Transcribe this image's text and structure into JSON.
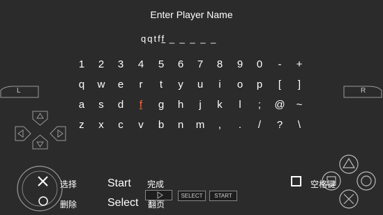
{
  "title": "Enter Player Name",
  "entry": {
    "typed": "qqtf",
    "current": "f",
    "blanks": "_ _ _ _ _"
  },
  "keyboard": {
    "rows": [
      [
        "1",
        "2",
        "3",
        "4",
        "5",
        "6",
        "7",
        "8",
        "9",
        "0",
        "-",
        "+"
      ],
      [
        "q",
        "w",
        "e",
        "r",
        "t",
        "y",
        "u",
        "i",
        "o",
        "p",
        "[",
        "]"
      ],
      [
        "a",
        "s",
        "d",
        "f",
        "g",
        "h",
        "j",
        "k",
        "l",
        ";",
        "@",
        "~"
      ],
      [
        "z",
        "x",
        "c",
        "v",
        "b",
        "n",
        "m",
        ",",
        ".",
        "/",
        "?",
        "\\"
      ]
    ],
    "selected": {
      "row": 2,
      "col": 3
    }
  },
  "shoulders": {
    "left": "L",
    "right": "R"
  },
  "controls": {
    "select_label": "选择",
    "delete_label": "删除",
    "start_label": "Start",
    "select_btn_label": "Select",
    "done_label": "完成",
    "page_label": "翻页",
    "select_small": "SELECT",
    "start_small": "START",
    "space_label": "空格键"
  },
  "colors": {
    "background": "#2b2b2b",
    "selected_key": "#ff6a3d",
    "control_outline": "#9a9a9a"
  }
}
